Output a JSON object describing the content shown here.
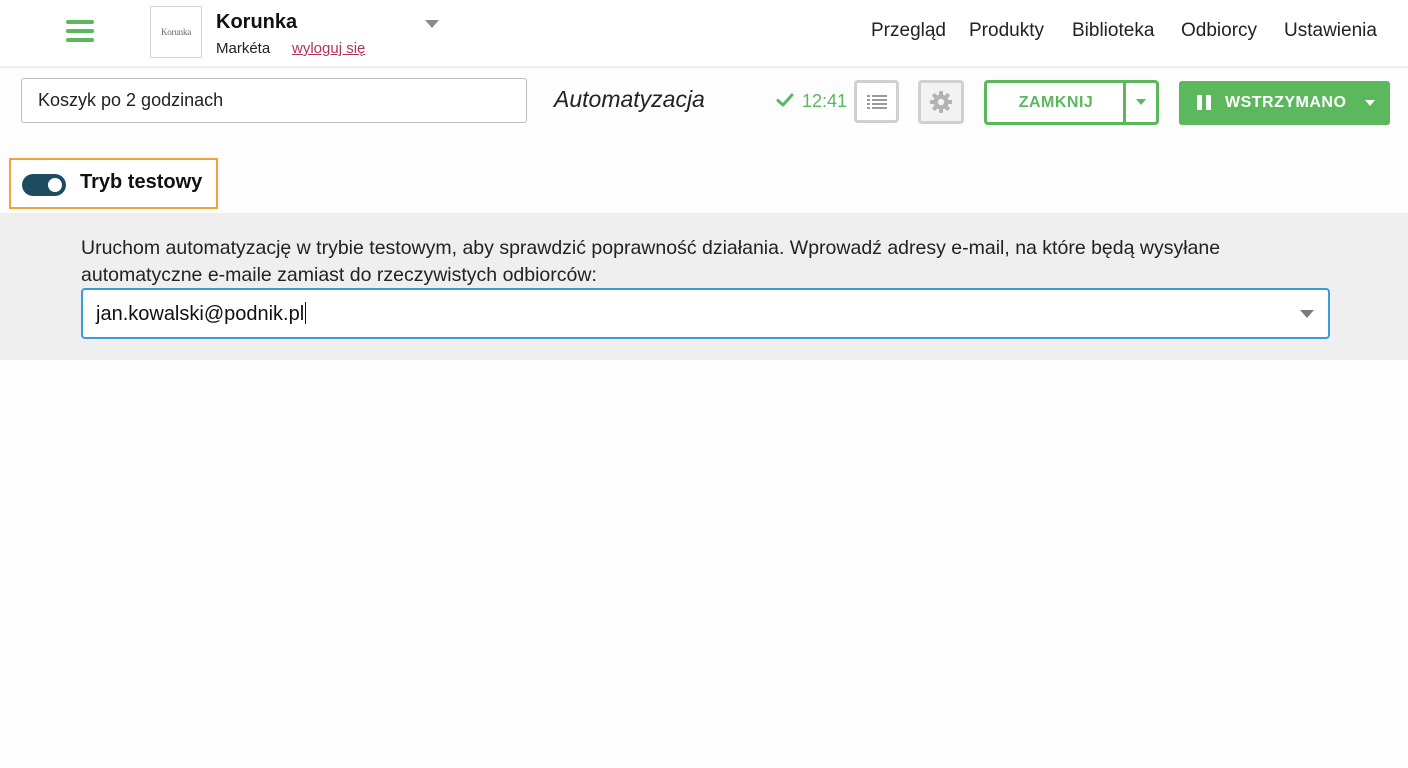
{
  "header": {
    "menu_icon": "hamburger-menu-icon",
    "logo_text": "Korunka",
    "account_name": "Korunka",
    "user_name": "Markéta",
    "logout_label": "wyloguj się",
    "nav": [
      "Przegląd",
      "Produkty",
      "Biblioteka",
      "Odbiorcy",
      "Ustawienia"
    ]
  },
  "toolbar": {
    "automation_name": "Koszyk po 2 godzinach",
    "page_type": "Automatyzacja",
    "saved_icon": "check-icon",
    "saved_time": "12:41",
    "list_icon": "list-icon",
    "settings_icon": "gear-icon",
    "close_label": "ZAMKNIJ",
    "status_label": "WSTRZYMANO",
    "status_icon": "pause-icon"
  },
  "test_mode": {
    "label": "Tryb testowy",
    "enabled": true,
    "description": "Uruchom automatyzację w trybie testowym, aby sprawdzić poprawność działania. Wprowadź adresy e-mail, na które będą wysyłane automatyczne e-maile zamiast do rzeczywistych odbiorców:",
    "email_value": "jan.kowalski@podnik.pl"
  },
  "colors": {
    "accent_green": "#5cb85c",
    "highlight_orange": "#f0a33a",
    "toggle_on": "#1f4b61",
    "focus_blue": "#3a9bd9",
    "logout_link": "#b5335a"
  }
}
